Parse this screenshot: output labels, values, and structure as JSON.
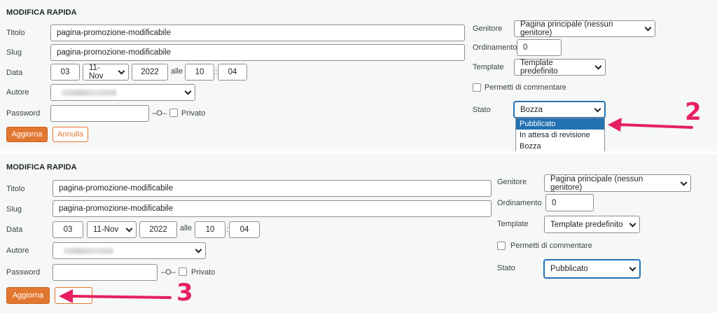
{
  "panel1": {
    "heading": "MODIFICA RAPIDA",
    "titolo_label": "Titolo",
    "titolo_value": "pagina-promozione-modificabile",
    "slug_label": "Slug",
    "slug_value": "pagina-promozione-modificabile",
    "data_label": "Data",
    "day": "03",
    "month": "11-Nov",
    "year": "2022",
    "alle": "alle",
    "hour": "10",
    "colon": ":",
    "minute": "04",
    "autore_label": "Autore",
    "password_label": "Password",
    "password_sep": "–O–",
    "privato": "Privato",
    "update_btn": "Aggiorna",
    "cancel_btn": "Annulla",
    "genitore_label": "Genitore",
    "genitore_value": "Pagina principale (nessun genitore)",
    "ordinamento_label": "Ordinamento",
    "ordinamento_value": "0",
    "template_label": "Template",
    "template_value": "Template predefinito",
    "commenti": "Permetti di commentare",
    "stato_label": "Stato",
    "stato_value": "Bozza",
    "stato_options": [
      "Pubblicato",
      "In attesa di revisione",
      "Bozza"
    ]
  },
  "panel2": {
    "heading": "MODIFICA RAPIDA",
    "titolo_label": "Titolo",
    "titolo_value": "pagina-promozione-modificabile",
    "slug_label": "Slug",
    "slug_value": "pagina-promozione-modificabile",
    "data_label": "Data",
    "day": "03",
    "month": "11-Nov",
    "year": "2022",
    "alle": "alle",
    "hour": "10",
    "colon": ":",
    "minute": "04",
    "autore_label": "Autore",
    "password_label": "Password",
    "password_sep": "–O–",
    "privato": "Privato",
    "update_btn": "Aggiorna",
    "genitore_label": "Genitore",
    "genitore_value": "Pagina principale (nessun genitore)",
    "ordinamento_label": "Ordinamento",
    "ordinamento_value": "0",
    "template_label": "Template",
    "template_value": "Template predefinito",
    "commenti": "Permetti di commentare",
    "stato_label": "Stato",
    "stato_value": "Pubblicato"
  },
  "annotations": {
    "step2": "2",
    "step3": "3",
    "accent": "#e61f63"
  },
  "colors": {
    "primary_button": "#e27730",
    "selection": "#2271b1"
  }
}
